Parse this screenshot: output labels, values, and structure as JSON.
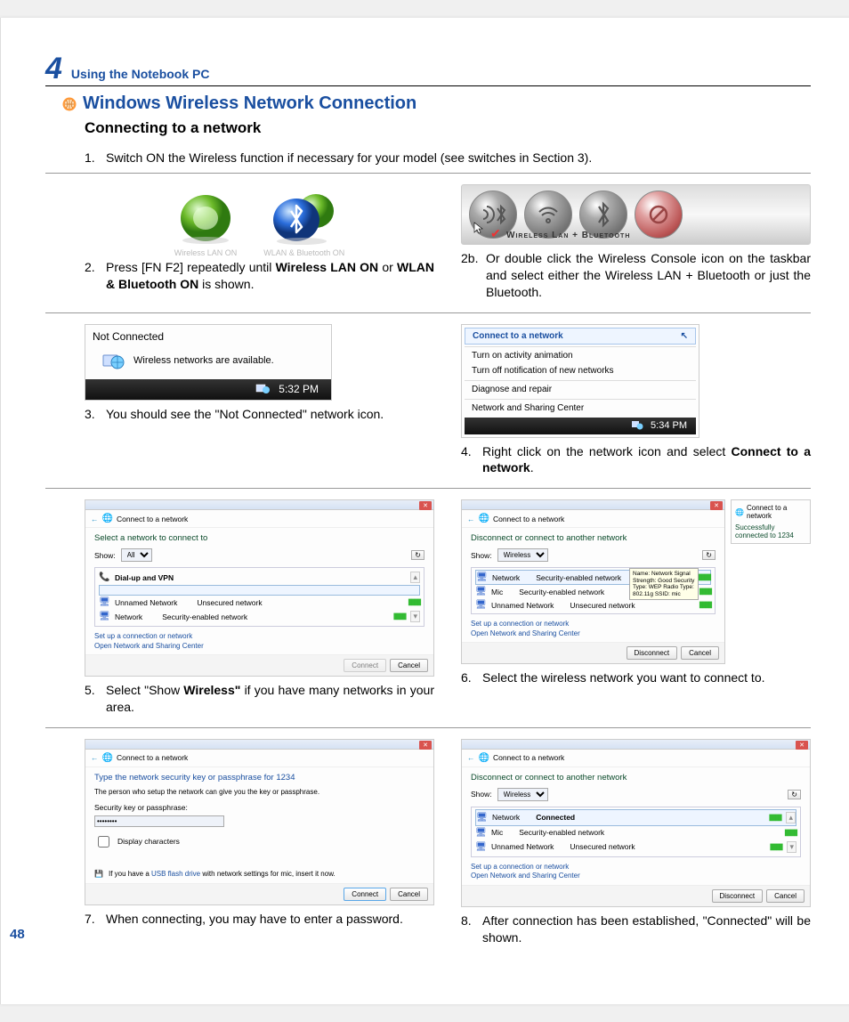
{
  "chapter": {
    "number": "4",
    "title": "Using the Notebook PC"
  },
  "section": {
    "title": "Windows Wireless Network Connection",
    "subtitle": "Connecting to a network"
  },
  "page_number": "48",
  "steps": {
    "s1": {
      "num": "1.",
      "text": "Switch ON the Wireless function if necessary for your model (see switches in Section 3)."
    },
    "s2": {
      "num": "2.",
      "text_before": "Press [FN F2] repeatedly until ",
      "bold1": "Wireless LAN ON",
      "mid": " or ",
      "bold2": "WLAN & Bluetooth ON",
      "after": " is shown.",
      "icon1_caption": "Wireless LAN ON",
      "icon2_caption": "WLAN & Bluetooth ON"
    },
    "s2b": {
      "num": "2b.",
      "text": "Or double click the Wireless Console icon on the taskbar and select either the Wireless LAN + Bluetooth or just the Bluetooth.",
      "ribbon": "Wireless Lan + Bluetooth"
    },
    "s3": {
      "num": "3.",
      "text": "You should see the \"Not Connected\" network icon.",
      "fig": {
        "title": "Not Connected",
        "body": "Wireless networks are available.",
        "time": "5:32 PM"
      }
    },
    "s4": {
      "num": "4.",
      "before": "Right click on the network icon and select ",
      "bold": "Connect to a network",
      "after": ".",
      "menu": {
        "i1": "Connect to a network",
        "i2": "Turn on activity animation",
        "i3": "Turn off notification of new networks",
        "i4": "Diagnose and repair",
        "i5": "Network and Sharing Center",
        "time": "5:34 PM"
      }
    },
    "s5": {
      "num": "5.",
      "before": "Select \"Show ",
      "bold": "Wireless\"",
      "after": " if you have many networks in your area.",
      "fig": {
        "crumb": "Connect to a network",
        "heading": "Select a network to connect to",
        "show_label": "Show:",
        "show_value": "All",
        "group": "Dial-up and VPN",
        "net1_name": "Unnamed Network",
        "net1_desc": "Unsecured network",
        "net2_name": "Network",
        "net2_desc": "Security-enabled network",
        "link1": "Set up a connection or network",
        "link2": "Open Network and Sharing Center",
        "btn_connect": "Connect",
        "btn_cancel": "Cancel"
      }
    },
    "s6": {
      "num": "6.",
      "text": "Select the wireless network you want to connect to.",
      "fig": {
        "crumb": "Connect to a network",
        "heading": "Disconnect or connect to another network",
        "show_label": "Show:",
        "show_value": "Wireless",
        "net1_name": "Network",
        "net1_desc": "Security-enabled network",
        "net2_name": "Mic",
        "net2_desc": "Security-enabled network",
        "net3_name": "Unnamed Network",
        "net3_desc": "Unsecured network",
        "link1": "Set up a connection or network",
        "link2": "Open Network and Sharing Center",
        "btn_disconnect": "Disconnect",
        "btn_cancel": "Cancel",
        "tooltip": "Name: Network\nSignal Strength: Good\nSecurity Type: WEP\nRadio Type: 802.11g\nSSID: mic",
        "side_crumb": "Connect to a network",
        "side_text": "Successfully connected to 1234"
      }
    },
    "s7": {
      "num": "7.",
      "text": "When connecting, you may have to enter a password.",
      "fig": {
        "crumb": "Connect to a network",
        "heading": "Type the network security key or passphrase for 1234",
        "sub": "The person who setup the network can give you the key or passphrase.",
        "label": "Security key or passphrase:",
        "value": "••••••••",
        "chk": "Display characters",
        "hint_before": "If you have a ",
        "hint_link": "USB flash drive",
        "hint_after": " with network settings for mic, insert it now.",
        "btn_connect": "Connect",
        "btn_cancel": "Cancel"
      }
    },
    "s8": {
      "num": "8.",
      "text": "After connection has been established, \"Connected\" will be shown.",
      "fig": {
        "crumb": "Connect to a network",
        "heading": "Disconnect or connect to another network",
        "show_label": "Show:",
        "show_value": "Wireless",
        "net1_name": "Network",
        "net1_desc": "Connected",
        "net2_name": "Mic",
        "net2_desc": "Security-enabled network",
        "net3_name": "Unnamed Network",
        "net3_desc": "Unsecured network",
        "link1": "Set up a connection or network",
        "link2": "Open Network and Sharing Center",
        "btn_disconnect": "Disconnect",
        "btn_cancel": "Cancel"
      }
    }
  }
}
